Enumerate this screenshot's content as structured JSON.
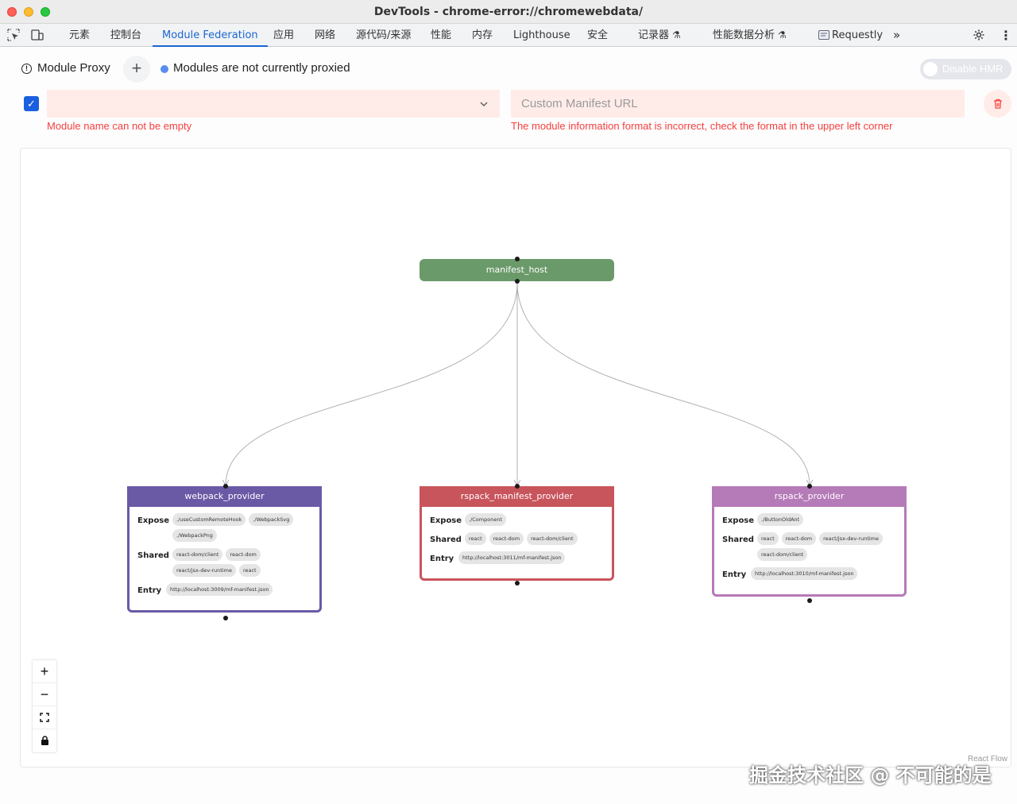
{
  "window": {
    "title": "DevTools - chrome-error://chromewebdata/"
  },
  "tabs": [
    {
      "label": "元素"
    },
    {
      "label": "控制台"
    },
    {
      "label": "Module Federation"
    },
    {
      "label": "应用"
    },
    {
      "label": "网络"
    },
    {
      "label": "源代码/来源"
    },
    {
      "label": "性能"
    },
    {
      "label": "内存"
    },
    {
      "label": "Lighthouse"
    },
    {
      "label": "安全"
    },
    {
      "label": "记录器"
    },
    {
      "label": "性能数据分析"
    },
    {
      "label": "Requestly"
    }
  ],
  "active_tab": "Module Federation",
  "toolbar": {
    "proxy_label": "Module Proxy",
    "add_symbol": "+",
    "status_text": "Modules are not currently proxied",
    "hmr_label": "Disable HMR"
  },
  "form": {
    "checkbox_mark": "✓",
    "url_placeholder": "Custom Manifest URL",
    "module_error": "Module name can not be empty",
    "url_error": "The module information format is incorrect, check the format in the upper left corner"
  },
  "graph": {
    "host": "manifest_host",
    "row_labels": {
      "expose": "Expose",
      "shared": "Shared",
      "entry": "Entry"
    },
    "providers": [
      {
        "name": "webpack_provider",
        "color": "#6a5aa6",
        "expose": [
          "./useCustomRemoteHook",
          "./WebpackSvg",
          "./WebpackPng"
        ],
        "shared": [
          "react-dom/client",
          "react-dom",
          "react/jsx-dev-runtime",
          "react"
        ],
        "entry": [
          "http://localhost:3009/mf-manifest.json"
        ]
      },
      {
        "name": "rspack_manifest_provider",
        "color": "#c8545c",
        "expose": [
          "./Component"
        ],
        "shared": [
          "react",
          "react-dom",
          "react-dom/client"
        ],
        "entry": [
          "http://localhost:3011/mf-manifest.json"
        ]
      },
      {
        "name": "rspack_provider",
        "color": "#b57ab8",
        "expose": [
          "./ButtonOldAnt"
        ],
        "shared": [
          "react",
          "react-dom",
          "react/jsx-dev-runtime",
          "react-dom/client"
        ],
        "entry": [
          "http://localhost:3010/mf-manifest.json"
        ]
      }
    ],
    "attribution": "React Flow"
  },
  "watermark": "掘金技术社区 @ 不可能的是"
}
